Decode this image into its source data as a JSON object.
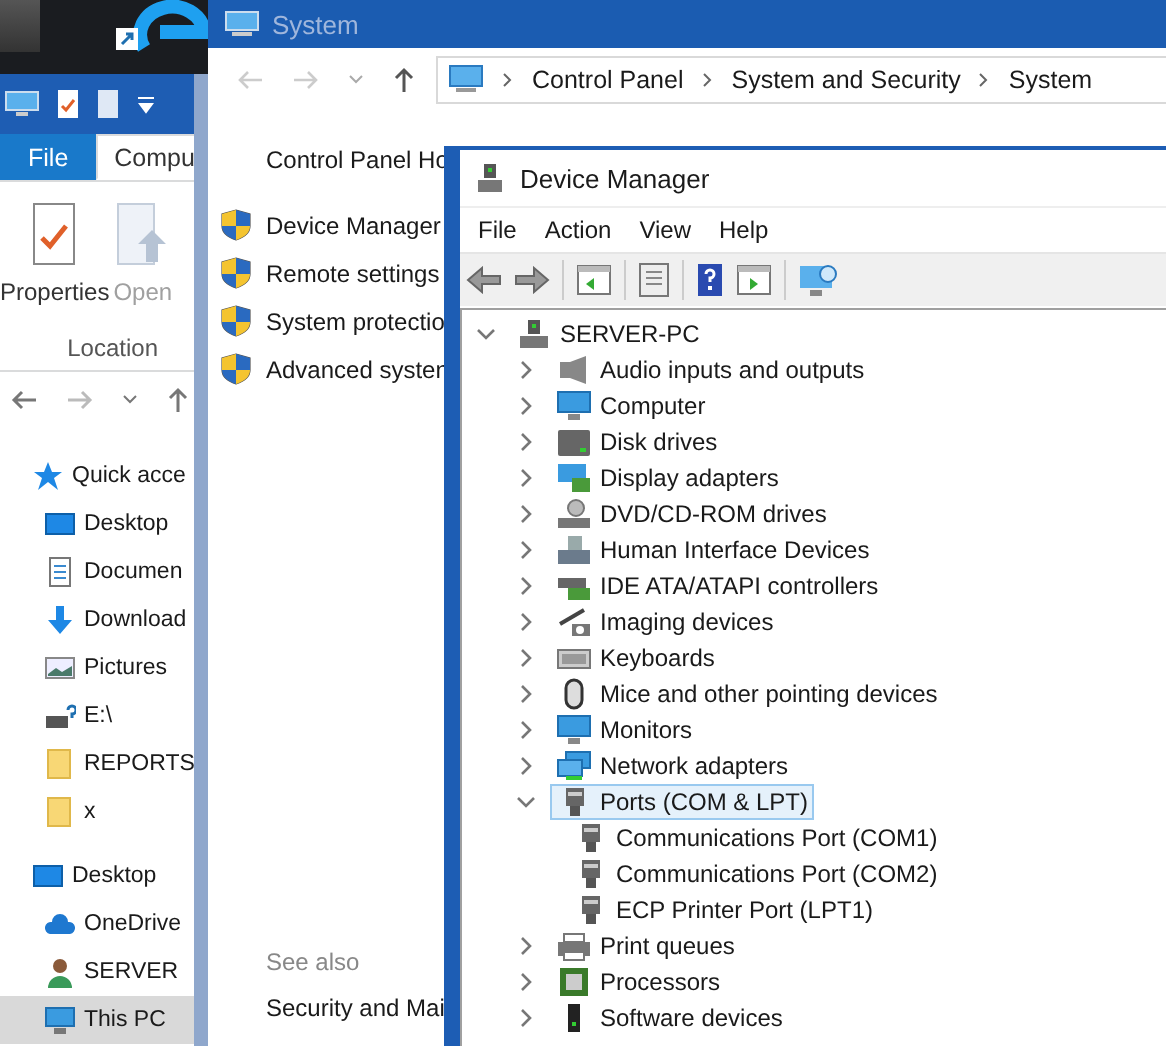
{
  "explorer": {
    "tabs": [
      {
        "label": "File",
        "kind": "file",
        "selected": false
      },
      {
        "label": "Compu",
        "kind": "tab",
        "selected": true
      }
    ],
    "ribbon_buttons": [
      {
        "label": "Properties",
        "kind": "properties",
        "disabled": false
      },
      {
        "label": "Open",
        "kind": "open",
        "disabled": true
      }
    ],
    "group_label": "Location",
    "nav_items": [
      {
        "label": "Quick acce",
        "kind": "star",
        "selected": false,
        "children": [
          {
            "label": "Desktop",
            "kind": "desktop",
            "selected": false
          },
          {
            "label": "Documen",
            "kind": "document",
            "selected": false
          },
          {
            "label": "Download",
            "kind": "download",
            "selected": false
          },
          {
            "label": "Pictures",
            "kind": "pictures",
            "selected": false
          },
          {
            "label": "E:\\",
            "kind": "drive",
            "selected": false
          },
          {
            "label": "REPORTS",
            "kind": "folder",
            "selected": false
          },
          {
            "label": "x",
            "kind": "folder",
            "selected": false
          }
        ]
      },
      {
        "label": "Desktop",
        "kind": "desktop",
        "selected": false,
        "children": [
          {
            "label": "OneDrive",
            "kind": "cloud",
            "selected": false
          },
          {
            "label": "SERVER",
            "kind": "user",
            "selected": false
          },
          {
            "label": "This PC",
            "kind": "pc",
            "selected": true
          }
        ]
      }
    ]
  },
  "system_window": {
    "title": "System",
    "breadcrumb": [
      "Control Panel",
      "System and Security",
      "System"
    ],
    "home_link": "Control Panel Ho",
    "tasks": [
      "Device Manager",
      "Remote settings",
      "System protectio",
      "Advanced systen"
    ],
    "see_also_heading": "See also",
    "see_also": [
      "Security and Mai"
    ]
  },
  "device_manager": {
    "title": "Device Manager",
    "menu": [
      "File",
      "Action",
      "View",
      "Help"
    ],
    "tree": {
      "label": "SERVER-PC",
      "kind": "computer",
      "expanded": true,
      "selected": false,
      "children": [
        {
          "label": "Audio inputs and outputs",
          "kind": "audio",
          "expanded": false,
          "selected": false
        },
        {
          "label": "Computer",
          "kind": "monitor",
          "expanded": false,
          "selected": false
        },
        {
          "label": "Disk drives",
          "kind": "disk",
          "expanded": false,
          "selected": false
        },
        {
          "label": "Display adapters",
          "kind": "display",
          "expanded": false,
          "selected": false
        },
        {
          "label": "DVD/CD-ROM drives",
          "kind": "dvd",
          "expanded": false,
          "selected": false
        },
        {
          "label": "Human Interface Devices",
          "kind": "hid",
          "expanded": false,
          "selected": false
        },
        {
          "label": "IDE ATA/ATAPI controllers",
          "kind": "ide",
          "expanded": false,
          "selected": false
        },
        {
          "label": "Imaging devices",
          "kind": "imaging",
          "expanded": false,
          "selected": false
        },
        {
          "label": "Keyboards",
          "kind": "keyboard",
          "expanded": false,
          "selected": false
        },
        {
          "label": "Mice and other pointing devices",
          "kind": "mouse",
          "expanded": false,
          "selected": false
        },
        {
          "label": "Monitors",
          "kind": "monitor",
          "expanded": false,
          "selected": false
        },
        {
          "label": "Network adapters",
          "kind": "network",
          "expanded": false,
          "selected": false
        },
        {
          "label": "Ports (COM & LPT)",
          "kind": "port",
          "expanded": true,
          "selected": true,
          "children": [
            {
              "label": "Communications Port (COM1)",
              "kind": "port",
              "selected": false
            },
            {
              "label": "Communications Port (COM2)",
              "kind": "port",
              "selected": false
            },
            {
              "label": "ECP Printer Port (LPT1)",
              "kind": "port",
              "selected": false
            }
          ]
        },
        {
          "label": "Print queues",
          "kind": "printer",
          "expanded": false,
          "selected": false
        },
        {
          "label": "Processors",
          "kind": "processor",
          "expanded": false,
          "selected": false
        },
        {
          "label": "Software devices",
          "kind": "software",
          "expanded": false,
          "selected": false
        }
      ]
    }
  }
}
